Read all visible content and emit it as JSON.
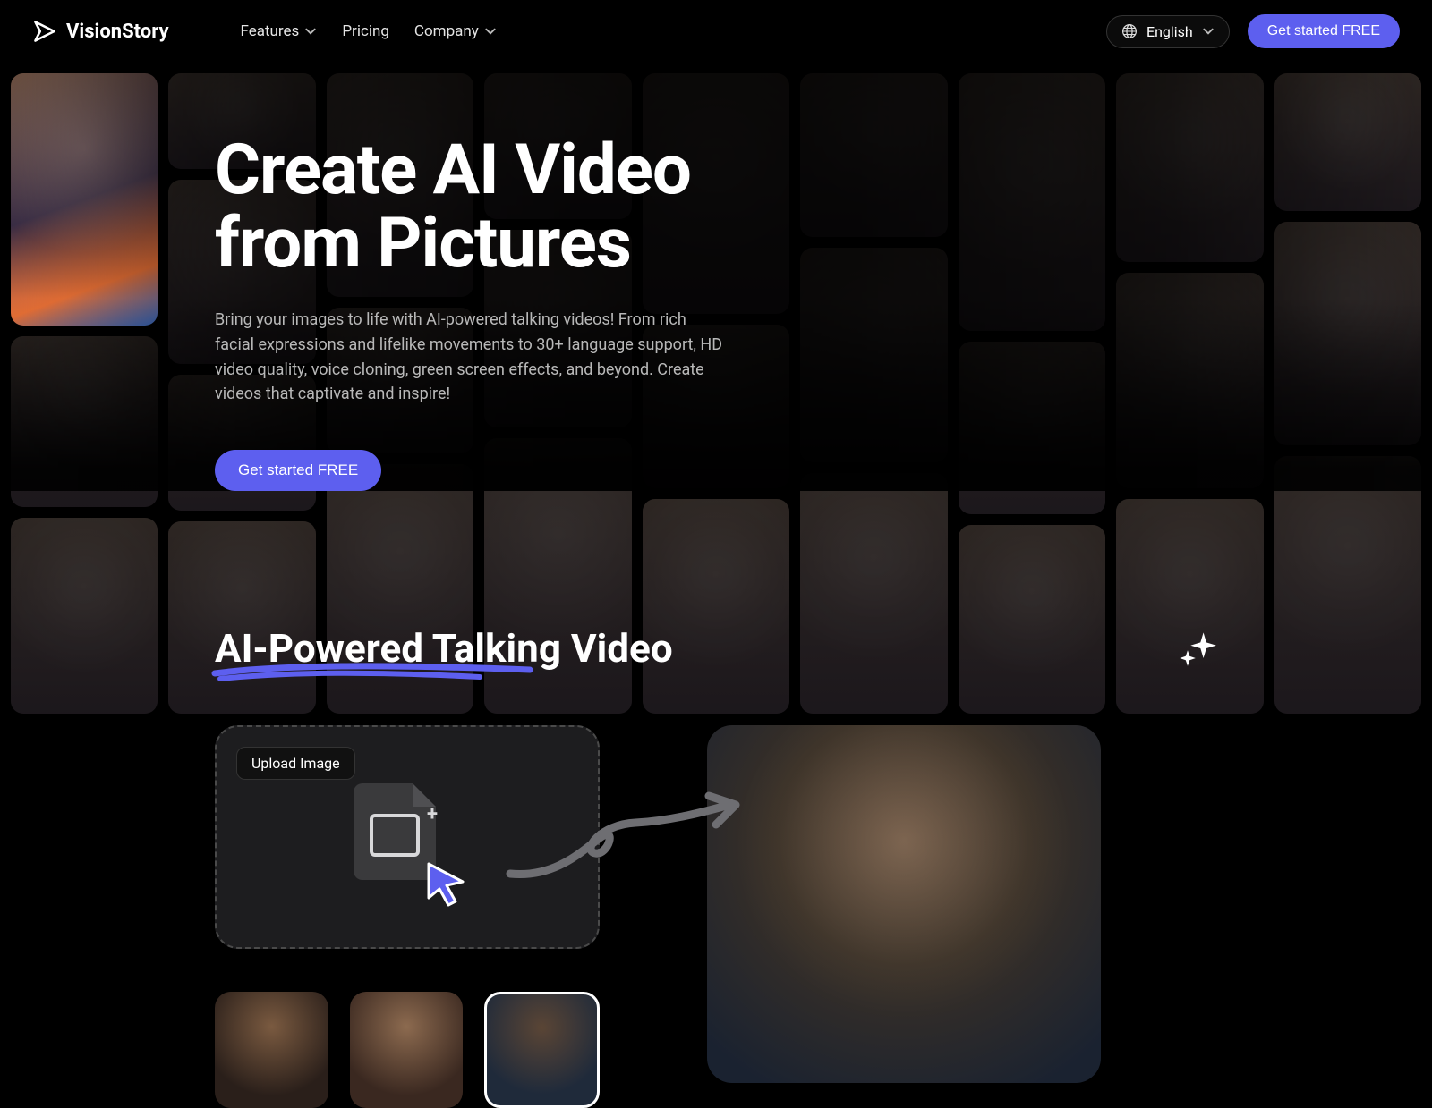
{
  "brand": {
    "name": "VisionStory"
  },
  "nav": {
    "features": "Features",
    "pricing": "Pricing",
    "company": "Company"
  },
  "lang": {
    "label": "English"
  },
  "cta": {
    "label": "Get started FREE"
  },
  "hero": {
    "title_line1": "Create AI Video",
    "title_line2": "from Pictures",
    "subtitle": "Bring your images to life with AI-powered talking videos! From rich facial expressions and lifelike movements to 30+ language support, HD video quality, voice cloning, green screen effects, and beyond. Create videos that captivate and inspire!",
    "cta": "Get started FREE"
  },
  "section2": {
    "title": "AI-Powered Talking Video",
    "upload_label": "Upload Image"
  }
}
